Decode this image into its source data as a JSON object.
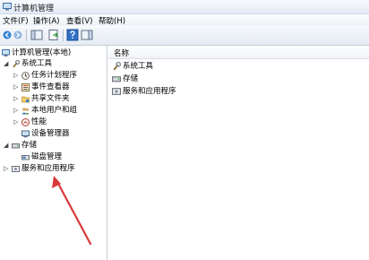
{
  "window": {
    "title": "计算机管理"
  },
  "menu": [
    {
      "label": "文件(F)"
    },
    {
      "label": "操作(A)"
    },
    {
      "label": "查看(V)"
    },
    {
      "label": "帮助(H)"
    }
  ],
  "tree": {
    "root": "计算机管理(本地)",
    "system_tools": "系统工具",
    "task_scheduler": "任务计划程序",
    "event_viewer": "事件查看器",
    "shared_folders": "共享文件夹",
    "local_users": "本地用户和组",
    "performance": "性能",
    "device_manager": "设备管理器",
    "storage": "存储",
    "disk_management": "磁盘管理",
    "services_apps": "服务和应用程序"
  },
  "list": {
    "column_name": "名称",
    "items": [
      {
        "label": "系统工具"
      },
      {
        "label": "存储"
      },
      {
        "label": "服务和应用程序"
      }
    ]
  },
  "colors": {
    "annotation_arrow": "#d93a3a"
  }
}
